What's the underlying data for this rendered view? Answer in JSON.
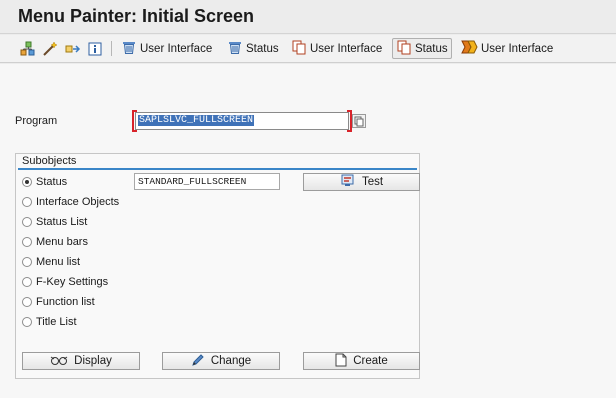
{
  "title": "Menu Painter: Initial Screen",
  "toolbar": {
    "buttons": [
      {
        "label": "User Interface",
        "icon": "delete-icon"
      },
      {
        "label": "Status",
        "icon": "delete-icon"
      },
      {
        "label": "User Interface",
        "icon": "copy-icon"
      },
      {
        "label": "Status",
        "icon": "copy-icon"
      },
      {
        "label": "User Interface",
        "icon": "check-icon"
      }
    ]
  },
  "program": {
    "label": "Program",
    "value": "SAPLSLVC_FULLSCREEN"
  },
  "subobjects": {
    "title": "Subobjects",
    "options": [
      {
        "label": "Status",
        "selected": true
      },
      {
        "label": "Interface Objects",
        "selected": false
      },
      {
        "label": "Status List",
        "selected": false
      },
      {
        "label": "Menu bars",
        "selected": false
      },
      {
        "label": "Menu list",
        "selected": false
      },
      {
        "label": "F-Key Settings",
        "selected": false
      },
      {
        "label": "Function list",
        "selected": false
      },
      {
        "label": "Title List",
        "selected": false
      }
    ],
    "status_value": "STANDARD_FULLSCREEN",
    "test_label": "Test"
  },
  "actions": {
    "display": "Display",
    "change": "Change",
    "create": "Create"
  },
  "colors": {
    "accent_blue": "#3a86c8",
    "required_red": "#d8232a",
    "selection_blue": "#3f72b8"
  }
}
